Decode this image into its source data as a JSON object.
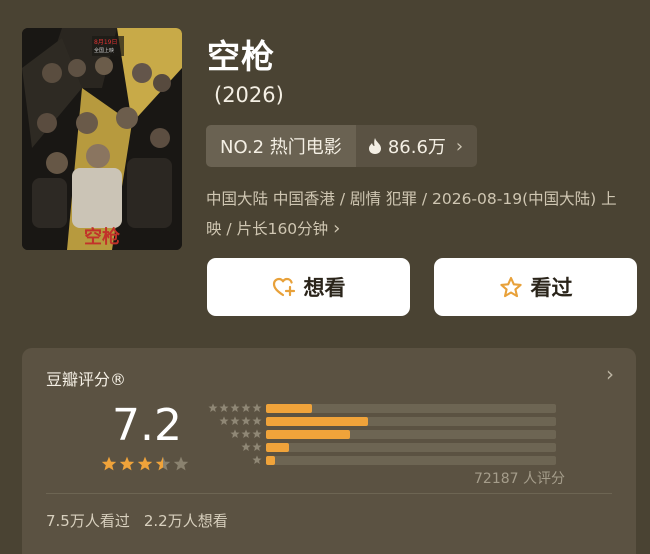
{
  "movie": {
    "title": "空枪",
    "year": "(2026)",
    "rank_label": "NO.2 热门电影",
    "heat": "86.6万",
    "meta_line": "中国大陆 中国香港 / 剧情 犯罪 / 2026-08-19(中国大陆) 上映 / 片长160分钟",
    "meta_chevron": "›"
  },
  "actions": {
    "want_label": "想看",
    "seen_label": "看过"
  },
  "rating": {
    "header": "豆瓣评分®",
    "chevron": "›",
    "score": "7.2",
    "star_fill": 3.5,
    "distribution": [
      0.16,
      0.35,
      0.29,
      0.08,
      0.03
    ],
    "count_text": "72187 人评分",
    "seen_text": "7.5万人看过",
    "want_text": "2.2万人想看"
  },
  "colors": {
    "accent": "#f0a33a",
    "background": "#4a4333",
    "card": "#5b5242"
  },
  "icons": {
    "flame": "flame-icon",
    "heart_add": "heart-plus-icon",
    "star": "star-outline-icon"
  }
}
